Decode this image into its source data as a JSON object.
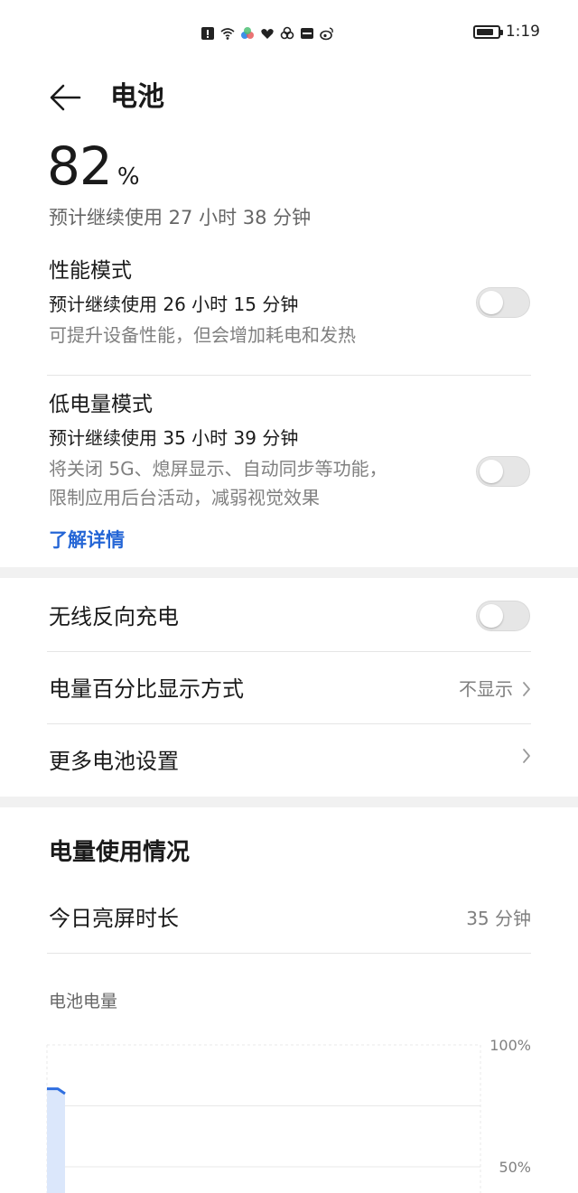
{
  "status_bar": {
    "icons": [
      "alert-icon",
      "wifi-icon",
      "app-icon",
      "heart-icon",
      "link-icon",
      "hms-icon",
      "weibo-icon"
    ],
    "time": "1:19",
    "battery_level": 0.82
  },
  "header": {
    "title": "电池"
  },
  "battery": {
    "percent": "82",
    "percent_symbol": "%",
    "estimate": "预计继续使用 27 小时 38 分钟"
  },
  "performance_mode": {
    "title": "性能模式",
    "estimate": "预计继续使用 26 小时 15 分钟",
    "description": "可提升设备性能，但会增加耗电和发热",
    "enabled": false
  },
  "low_power_mode": {
    "title": "低电量模式",
    "estimate": "预计继续使用 35 小时 39 分钟",
    "description_line1": "将关闭 5G、熄屏显示、自动同步等功能，",
    "description_line2": "限制应用后台活动，减弱视觉效果",
    "enabled": false,
    "learn_more": "了解详情"
  },
  "wireless_reverse_charging": {
    "title": "无线反向充电",
    "enabled": false
  },
  "percentage_display": {
    "title": "电量百分比显示方式",
    "value": "不显示"
  },
  "more_settings": {
    "title": "更多电池设置"
  },
  "usage": {
    "section_title": "电量使用情况",
    "screen_time_label": "今日亮屏时长",
    "screen_time_value": "35 分钟",
    "chart_label": "电池电量"
  },
  "chart_data": {
    "type": "area",
    "ytick_labels": [
      "100%",
      "50%"
    ],
    "ylim": [
      0,
      100
    ],
    "series": [
      {
        "values": [
          82,
          82,
          80
        ]
      }
    ],
    "colors": {
      "line": "#2f6fe0",
      "fill": "#dbe7fb",
      "grid": "#e8e8e8"
    }
  }
}
